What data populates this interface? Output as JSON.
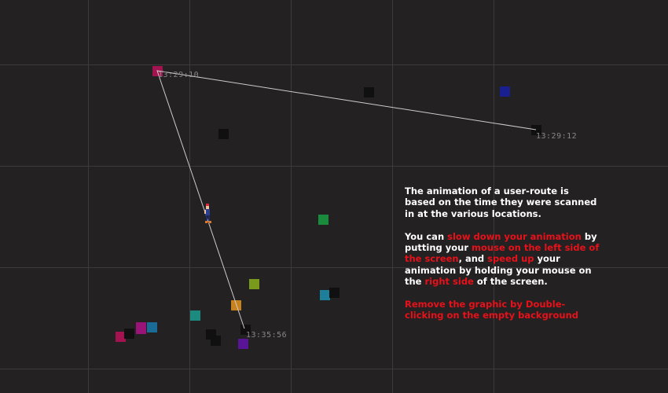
{
  "colors": {
    "background": "#242122",
    "grid": "#3d3a3b",
    "route_line": "#cfcbcc",
    "timestamp_text": "#8a8687",
    "info_text": "#ffffff",
    "highlight_text": "#e8111a"
  },
  "route": {
    "timestamps": [
      "13:29:12",
      "13:29:10",
      "13:35:56"
    ]
  },
  "markers": [
    {
      "color": "#a3134f"
    },
    {
      "color": "#111011"
    },
    {
      "color": "#1a1f8f"
    },
    {
      "color": "#111011"
    },
    {
      "color": "#111011"
    },
    {
      "color": "#1a8a3c"
    },
    {
      "color": "#7a9a1c"
    },
    {
      "color": "#1e7f9a"
    },
    {
      "color": "#111011"
    },
    {
      "color": "#c7821d"
    },
    {
      "color": "#1d8a80"
    },
    {
      "color": "#1a6c96"
    },
    {
      "color": "#9a1379"
    },
    {
      "color": "#a3134f"
    },
    {
      "color": "#111011"
    },
    {
      "color": "#111011"
    },
    {
      "color": "#111011"
    },
    {
      "color": "#111011"
    },
    {
      "color": "#5a1596"
    }
  ],
  "walker": {
    "icon": "walking-person-icon"
  },
  "info": {
    "p1": "The animation of a user-route is based on the time they were scanned in at the various locations.",
    "p2_a": "You can ",
    "p2_b": "slow down your animation",
    "p2_c": " by putting your ",
    "p2_d": "mouse on the left side of the screen",
    "p2_e": ", and ",
    "p2_f": "speed up",
    "p2_g": " your animation by holding your mouse on the ",
    "p2_h": "right side",
    "p2_i": " of the screen.",
    "p3": "Remove the graphic by Double-clicking on the empty background"
  }
}
